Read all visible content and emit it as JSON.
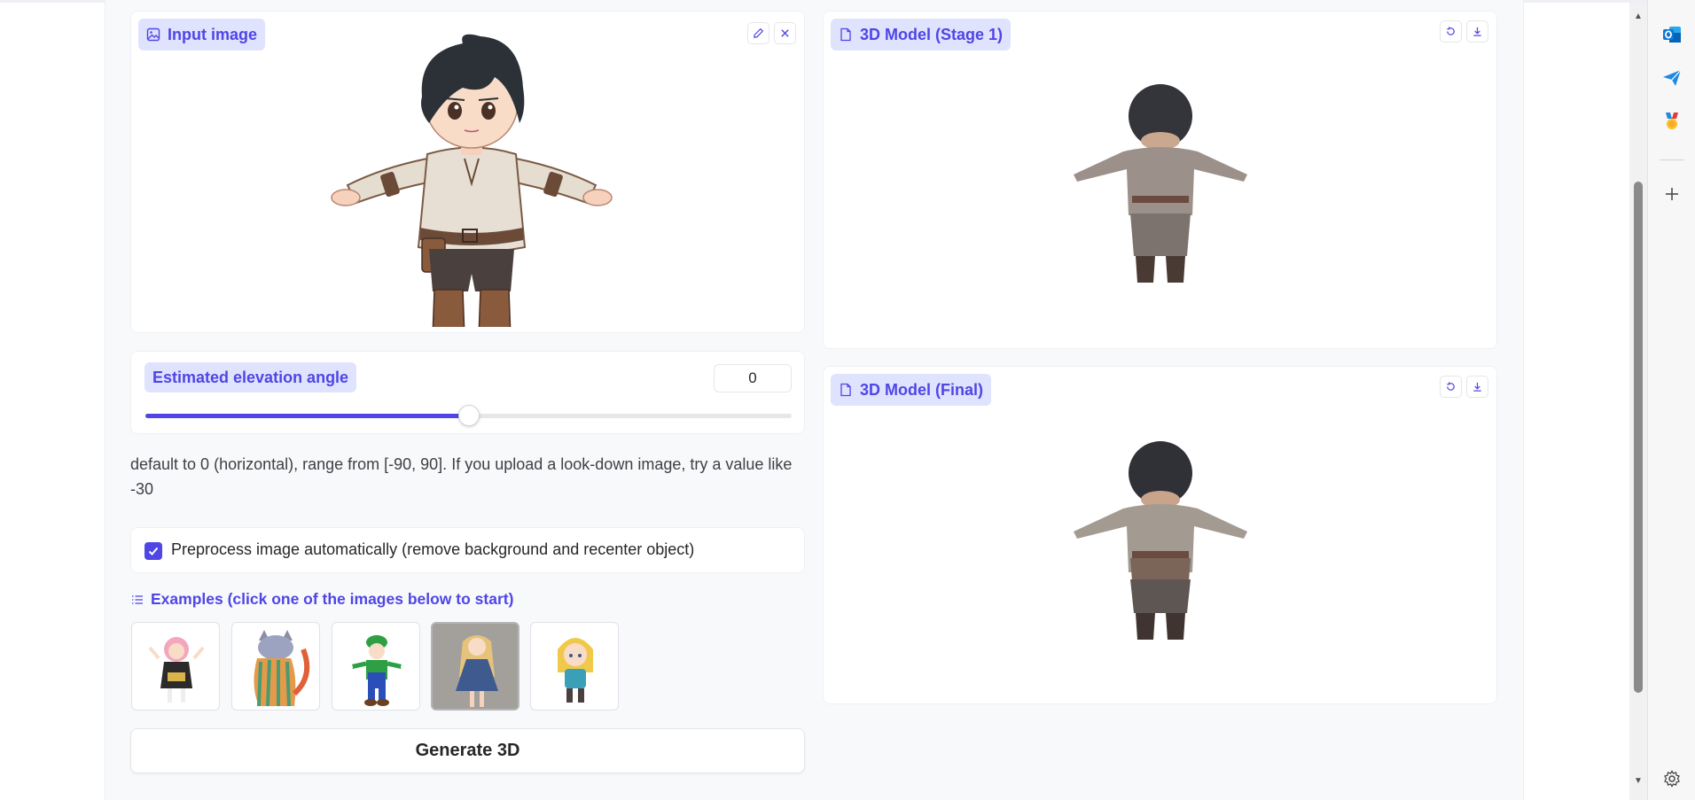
{
  "input_image": {
    "label": "Input image",
    "icon": "image-icon",
    "tools": [
      "edit-icon",
      "close-icon"
    ]
  },
  "elevation": {
    "label": "Estimated elevation angle",
    "value": "0",
    "slider_min": -90,
    "slider_max": 90,
    "slider_value": 0,
    "help_text": "default to 0 (horizontal), range from [-90, 90]. If you upload a look-down image, try a value like -30"
  },
  "preprocess": {
    "checked": true,
    "label": "Preprocess image automatically (remove background and recenter object)"
  },
  "examples": {
    "title": "Examples (click one of the images below to start)",
    "items": [
      "example-pink-hair-girl",
      "example-striped-cat",
      "example-luigi",
      "example-blonde-girl",
      "example-blonde-elf"
    ]
  },
  "generate_button": "Generate 3D",
  "model_stage1": {
    "label": "3D Model (Stage 1)",
    "icon": "file-icon",
    "tools": [
      "reset-icon",
      "download-icon"
    ]
  },
  "model_final": {
    "label": "3D Model (Final)",
    "icon": "file-icon",
    "tools": [
      "reset-icon",
      "download-icon"
    ]
  },
  "colors": {
    "accent": "#4f46e5",
    "chip_bg": "#dfe3fd"
  },
  "sidebar_icons": [
    "outlook-icon",
    "send-icon",
    "medal-icon",
    "add-icon",
    "settings-icon"
  ]
}
